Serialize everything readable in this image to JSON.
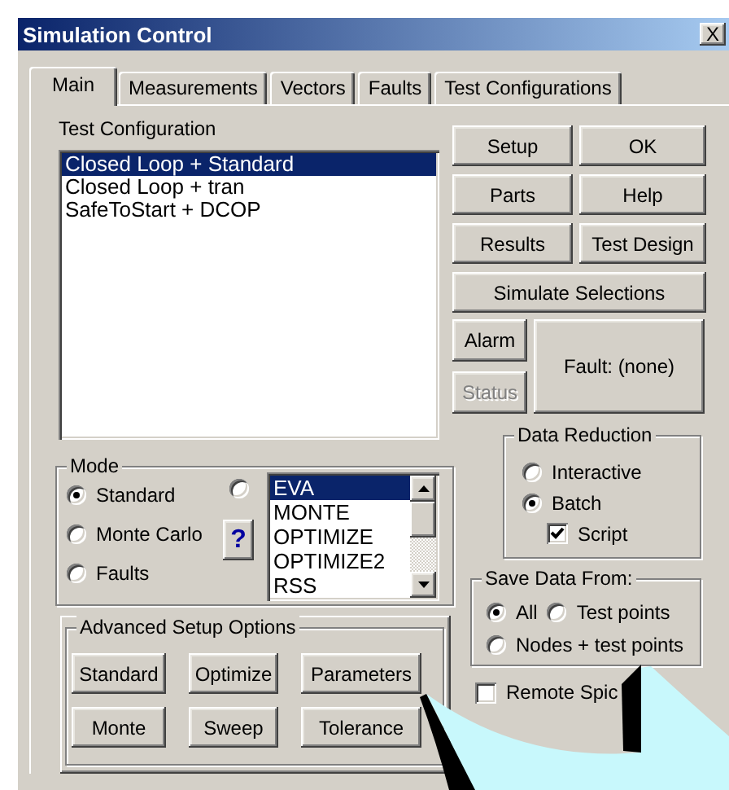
{
  "window": {
    "title": "Simulation Control",
    "close": "X"
  },
  "tabs": [
    {
      "label": "Main",
      "selected": true
    },
    {
      "label": "Measurements",
      "selected": false
    },
    {
      "label": "Vectors",
      "selected": false
    },
    {
      "label": "Faults",
      "selected": false
    },
    {
      "label": "Test Configurations",
      "selected": false
    }
  ],
  "test_configuration": {
    "label": "Test Configuration",
    "items": [
      {
        "label": "Closed Loop + Standard",
        "selected": true
      },
      {
        "label": "Closed Loop + tran",
        "selected": false
      },
      {
        "label": "SafeToStart + DCOP",
        "selected": false
      }
    ]
  },
  "buttons": [
    "Setup",
    "OK",
    "Parts",
    "Help",
    "Results",
    "Test Design",
    "Simulate Selections"
  ],
  "side_buttons": [
    {
      "label": "Alarm",
      "disabled": false
    },
    {
      "label": "Status",
      "disabled": true
    }
  ],
  "fault": {
    "label": "Fault: (none)"
  },
  "mode": {
    "label": "Mode",
    "options": [
      {
        "label": "Standard",
        "selected": true
      },
      {
        "label": "Monte Carlo",
        "selected": false
      },
      {
        "label": "Faults",
        "selected": false
      }
    ],
    "list_option": {
      "selected": false
    },
    "help_button": "?",
    "list": {
      "items": [
        {
          "label": "EVA",
          "selected": true
        },
        {
          "label": "MONTE",
          "selected": false
        },
        {
          "label": "OPTIMIZE",
          "selected": false
        },
        {
          "label": "OPTIMIZE2",
          "selected": false
        },
        {
          "label": "RSS",
          "selected": false
        }
      ]
    }
  },
  "advanced": {
    "label": "Advanced Setup Options",
    "buttons": [
      "Standard",
      "Optimize",
      "Parameters",
      "Monte",
      "Sweep",
      "Tolerance"
    ]
  },
  "data_reduction": {
    "label": "Data Reduction",
    "options": [
      {
        "label": "Interactive",
        "selected": false
      },
      {
        "label": "Batch",
        "selected": true
      }
    ],
    "script": {
      "label": "Script",
      "checked": true
    }
  },
  "save_data_from": {
    "label": "Save Data From:",
    "options": [
      {
        "label": "All",
        "selected": true
      },
      {
        "label": "Test points",
        "selected": false
      },
      {
        "label": "Nodes + test points",
        "selected": false
      }
    ]
  },
  "remote_spice": {
    "label": "Remote Spic",
    "checked": false
  }
}
